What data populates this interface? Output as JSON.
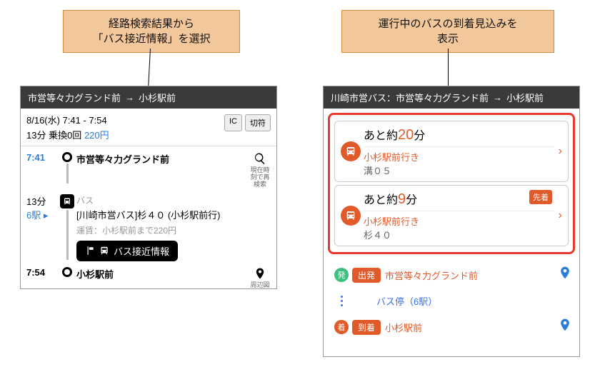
{
  "callouts": {
    "left_line1": "経路検索結果から",
    "left_line2": "「バス接近情報」を選択",
    "right_line1": "運行中のバスの到着見込みを",
    "right_line2": "表示"
  },
  "left_phone": {
    "header_from": "市営等々力グランド前",
    "header_arrow": "→",
    "header_to": "小杉駅前",
    "summary_date_time": "8/16(水) 7:41 - 7:54",
    "summary_duration": "13分 乗換0回",
    "summary_fare": "220円",
    "badge_ic": "IC",
    "badge_ticket": "切符",
    "depart_time": "7:41",
    "depart_name": "市営等々力グランド前",
    "search_sub": "現在時刻で再検索",
    "seg_duration": "13分",
    "seg_stops": "6駅 ▸",
    "seg_type": "バス",
    "seg_route": "[川崎市営バス]杉４０ (小杉駅前行)",
    "seg_fare": "運賃：小杉駅前まで220円",
    "approach_label": "バス接近情報",
    "arrive_time": "7:54",
    "arrive_name": "小杉駅前",
    "map_sub": "周辺図"
  },
  "right_phone": {
    "header_operator": "川崎市営バス",
    "header_sep": "：",
    "header_from": "市営等々力グランド前",
    "header_arrow": "→",
    "header_to": "小杉駅前",
    "arrivals": [
      {
        "eta_prefix": "あと約",
        "eta_num": "20",
        "eta_suffix": "分",
        "dest": "小杉駅前行き",
        "route": "溝０５",
        "first": false
      },
      {
        "eta_prefix": "あと約",
        "eta_num": "9",
        "eta_suffix": "分",
        "dest": "小杉駅前行き",
        "route": "杉４０",
        "first": true
      }
    ],
    "first_tag": "先着",
    "dep_badge_char": "発",
    "dep_pill": "出発",
    "dep_name": "市営等々力グランド前",
    "mid_label": "バス停（6駅）",
    "arr_badge_char": "着",
    "arr_pill": "到着",
    "arr_name": "小杉駅前"
  }
}
